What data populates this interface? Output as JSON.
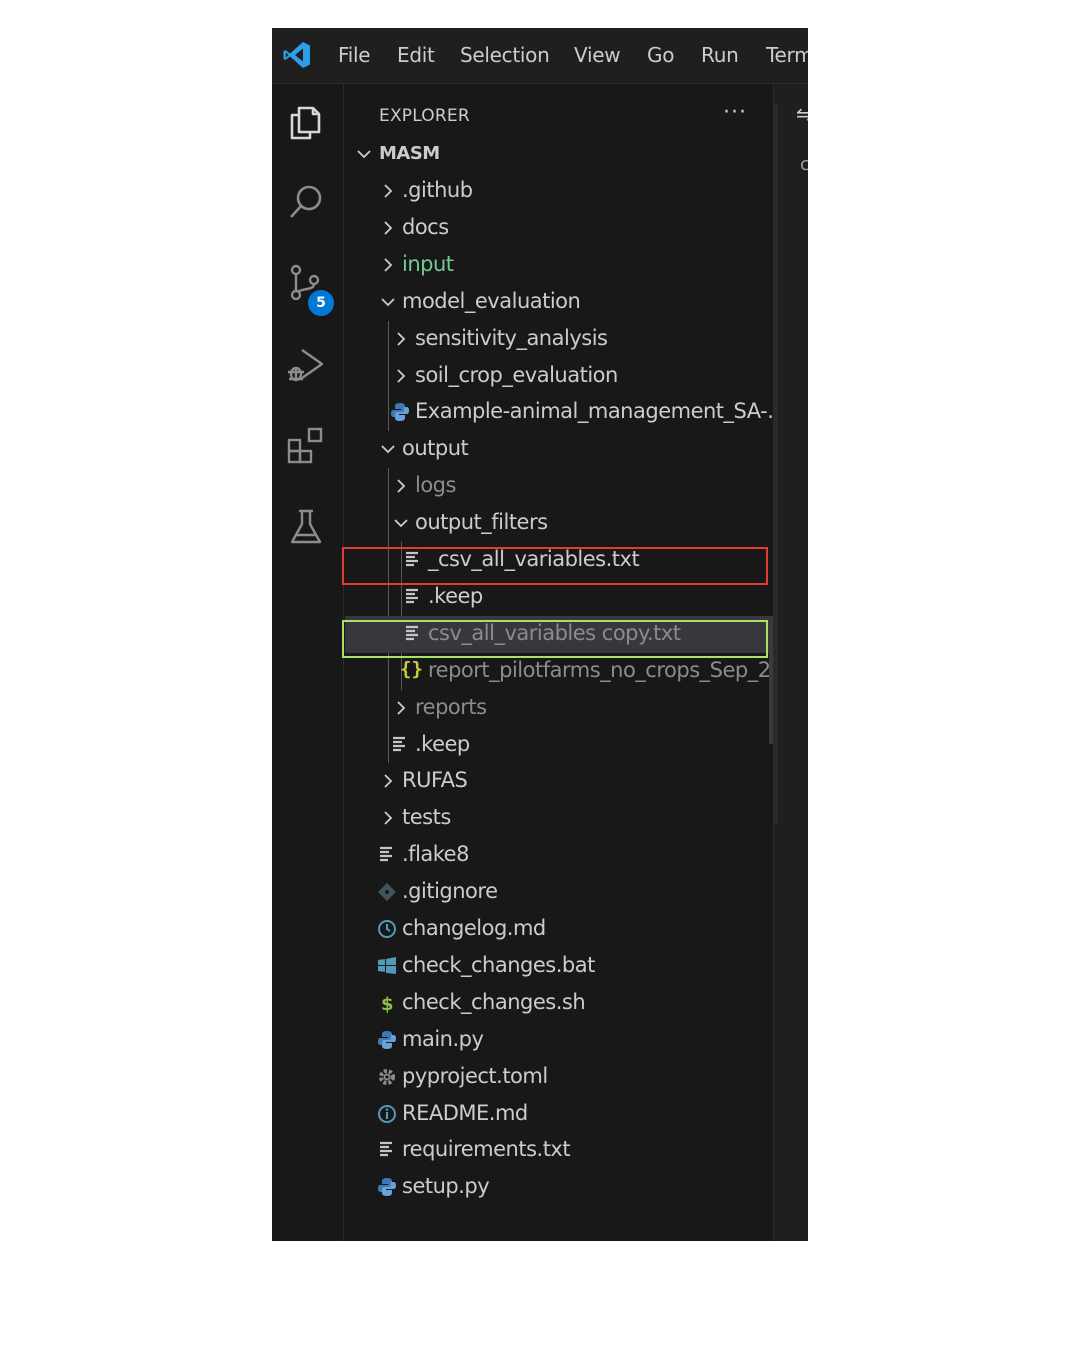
{
  "menu": {
    "items": [
      "File",
      "Edit",
      "Selection",
      "View",
      "Go",
      "Run",
      "Term"
    ]
  },
  "activity_bar": {
    "icons": [
      "files-icon",
      "search-icon",
      "source-control-icon",
      "run-debug-icon",
      "extensions-icon",
      "testing-icon"
    ],
    "source_control_badge": "5"
  },
  "explorer": {
    "title": "EXPLORER",
    "more_label": "···",
    "root": "MASM"
  },
  "tree": [
    {
      "label": ".github",
      "type": "folder",
      "expanded": false,
      "status": "normal"
    },
    {
      "label": "docs",
      "type": "folder",
      "expanded": false,
      "status": "normal"
    },
    {
      "label": "input",
      "type": "folder",
      "expanded": false,
      "status": "untracked"
    },
    {
      "label": "model_evaluation",
      "type": "folder",
      "expanded": true,
      "status": "normal"
    },
    {
      "label": "sensitivity_analysis",
      "type": "folder",
      "expanded": false,
      "status": "normal"
    },
    {
      "label": "soil_crop_evaluation",
      "type": "folder",
      "expanded": false,
      "status": "normal"
    },
    {
      "label": "Example-animal_management_SA-...",
      "type": "python",
      "status": "normal"
    },
    {
      "label": "output",
      "type": "folder",
      "expanded": true,
      "status": "normal"
    },
    {
      "label": "logs",
      "type": "folder",
      "expanded": false,
      "status": "ignored"
    },
    {
      "label": "output_filters",
      "type": "folder",
      "expanded": true,
      "status": "normal"
    },
    {
      "label": "_csv_all_variables.txt",
      "type": "text",
      "status": "normal",
      "annotation": "red-box"
    },
    {
      "label": ".keep",
      "type": "text",
      "status": "normal"
    },
    {
      "label": "csv_all_variables copy.txt",
      "type": "text",
      "status": "ignored",
      "annotation": "green-box",
      "selected": true
    },
    {
      "label": "report_pilotfarms_no_crops_Sep_2...",
      "type": "json",
      "status": "ignored"
    },
    {
      "label": "reports",
      "type": "folder",
      "expanded": false,
      "status": "ignored"
    },
    {
      "label": ".keep",
      "type": "text",
      "status": "normal"
    },
    {
      "label": "RUFAS",
      "type": "folder",
      "expanded": false,
      "status": "normal"
    },
    {
      "label": "tests",
      "type": "folder",
      "expanded": false,
      "status": "normal"
    },
    {
      "label": ".flake8",
      "type": "text",
      "status": "normal"
    },
    {
      "label": ".gitignore",
      "type": "git",
      "status": "normal"
    },
    {
      "label": "changelog.md",
      "type": "changelog",
      "status": "normal"
    },
    {
      "label": "check_changes.bat",
      "type": "windows",
      "status": "normal"
    },
    {
      "label": "check_changes.sh",
      "type": "shell",
      "status": "normal"
    },
    {
      "label": "main.py",
      "type": "python",
      "status": "normal"
    },
    {
      "label": "pyproject.toml",
      "type": "settings",
      "status": "normal"
    },
    {
      "label": "README.md",
      "type": "info",
      "status": "normal"
    },
    {
      "label": "requirements.txt",
      "type": "text",
      "status": "normal"
    },
    {
      "label": "setup.py",
      "type": "python",
      "status": "normal"
    }
  ],
  "editor_fragments": [
    "⇋",
    "c"
  ],
  "colors": {
    "background": "#181818",
    "text": "#cccccc",
    "untracked": "#73c991",
    "ignored": "#8c8c8c",
    "badge": "#0078d4",
    "red_box": "#e53935",
    "green_box": "#a7e366",
    "selection": "#37373d"
  }
}
